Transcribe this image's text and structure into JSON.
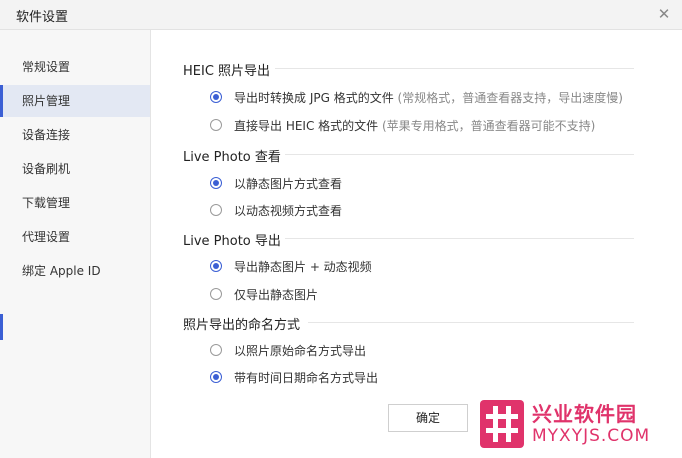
{
  "window": {
    "title": "软件设置",
    "close_icon": "close-icon"
  },
  "sidebar": {
    "items": [
      {
        "label": "常规设置",
        "active": false
      },
      {
        "label": "照片管理",
        "active": true
      },
      {
        "label": "设备连接",
        "active": false
      },
      {
        "label": "设备刷机",
        "active": false
      },
      {
        "label": "下载管理",
        "active": false
      },
      {
        "label": "代理设置",
        "active": false
      },
      {
        "label": "绑定 Apple ID",
        "active": false
      }
    ]
  },
  "sections": [
    {
      "title": "HEIC 照片导出",
      "options": [
        {
          "label": "导出时转换成 JPG 格式的文件",
          "note": "(常规格式，普通查看器支持，导出速度慢)",
          "checked": true
        },
        {
          "label": "直接导出 HEIC 格式的文件",
          "note": "(苹果专用格式，普通查看器可能不支持)",
          "checked": false
        }
      ]
    },
    {
      "title": "Live Photo 查看",
      "options": [
        {
          "label": "以静态图片方式查看",
          "note": "",
          "checked": true
        },
        {
          "label": "以动态视频方式查看",
          "note": "",
          "checked": false
        }
      ]
    },
    {
      "title": "Live Photo 导出",
      "options": [
        {
          "label": "导出静态图片 + 动态视频",
          "note": "",
          "checked": true
        },
        {
          "label": "仅导出静态图片",
          "note": "",
          "checked": false
        }
      ]
    },
    {
      "title": "照片导出的命名方式",
      "options": [
        {
          "label": "以照片原始命名方式导出",
          "note": "",
          "checked": false
        },
        {
          "label": "带有时间日期命名方式导出",
          "note": "",
          "checked": true
        }
      ]
    }
  ],
  "footer": {
    "ok_label": "确定"
  },
  "watermark": {
    "name": "兴业软件园",
    "url": "MYXYJS.COM"
  },
  "colors": {
    "accent": "#3b5fd4",
    "watermark": "#e0336b"
  }
}
